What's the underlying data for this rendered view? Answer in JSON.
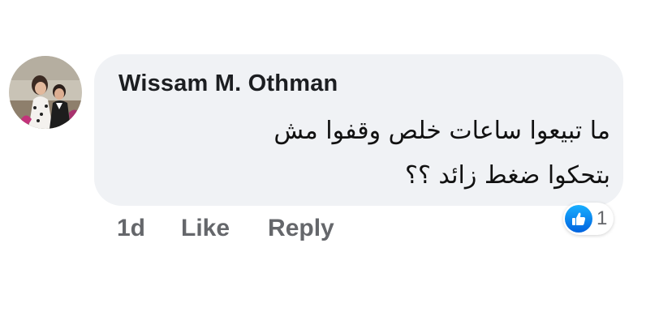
{
  "comment": {
    "author": "Wissam M. Othman",
    "lines": [
      "ما تبيعوا ساعات خلص وقفوا مش",
      "بتحكوا ضغط زائد ؟؟"
    ]
  },
  "actions": {
    "timestamp": "1d",
    "like_label": "Like",
    "reply_label": "Reply"
  },
  "reactions": {
    "icon": "thumbs-up-icon",
    "count": "1"
  },
  "colors": {
    "bubble": "#f0f2f5",
    "action_text": "#65676b",
    "like_blue": "#1877f2"
  }
}
